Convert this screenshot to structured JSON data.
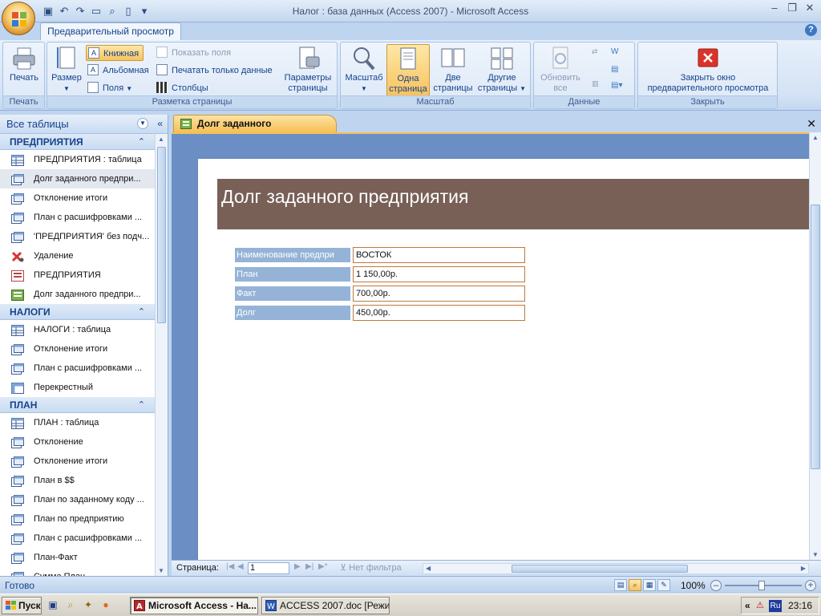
{
  "window": {
    "title": "Налог : база данных (Access 2007) - Microsoft Access"
  },
  "ribbon": {
    "tab": "Предварительный просмотр",
    "groups": {
      "print": {
        "label": "Печать",
        "print_btn": "Печать"
      },
      "page_layout": {
        "label": "Разметка страницы",
        "size_btn": "Размер",
        "portrait_btn": "Книжная",
        "landscape_btn": "Альбомная",
        "margins_btn": "Поля",
        "show_margins": "Показать поля",
        "print_data_only": "Печатать только данные",
        "columns_btn": "Столбцы",
        "page_setup_btn_line1": "Параметры",
        "page_setup_btn_line2": "страницы"
      },
      "zoom": {
        "label": "Масштаб",
        "zoom_btn": "Масштаб",
        "one_page_line1": "Одна",
        "one_page_line2": "страница",
        "two_pages_line1": "Две",
        "two_pages_line2": "страницы",
        "more_pages_line1": "Другие",
        "more_pages_line2": "страницы"
      },
      "data": {
        "label": "Данные",
        "refresh_line1": "Обновить",
        "refresh_line2": "все"
      },
      "close": {
        "label": "Закрыть",
        "close_line1": "Закрыть окно",
        "close_line2": "предварительного просмотра"
      }
    }
  },
  "nav": {
    "header": "Все таблицы",
    "groups": [
      {
        "title": "ПРЕДПРИЯТИЯ",
        "items": [
          {
            "label": "ПРЕДПРИЯТИЯ : таблица",
            "icon": "table-icon"
          },
          {
            "label": "Долг заданного предпри...",
            "icon": "query-icon",
            "selected": true
          },
          {
            "label": "Отклонение итоги",
            "icon": "query-icon"
          },
          {
            "label": "План с расшифровками ...",
            "icon": "query-icon"
          },
          {
            "label": "'ПРЕДПРИЯТИЯ' без подч...",
            "icon": "query-icon"
          },
          {
            "label": "Удаление",
            "icon": "delete-query-icon"
          },
          {
            "label": "ПРЕДПРИЯТИЯ",
            "icon": "form-icon"
          },
          {
            "label": "Долг заданного предпри...",
            "icon": "report-icon"
          }
        ]
      },
      {
        "title": "НАЛОГИ",
        "items": [
          {
            "label": "НАЛОГИ : таблица",
            "icon": "table-icon"
          },
          {
            "label": "Отклонение итоги",
            "icon": "query-icon"
          },
          {
            "label": "План с расшифровками ...",
            "icon": "query-icon"
          },
          {
            "label": "Перекрестный",
            "icon": "crosstab-icon"
          }
        ]
      },
      {
        "title": "ПЛАН",
        "items": [
          {
            "label": "ПЛАН : таблица",
            "icon": "table-icon"
          },
          {
            "label": "Отклонение",
            "icon": "query-icon"
          },
          {
            "label": "Отклонение итоги",
            "icon": "query-icon"
          },
          {
            "label": "План в $$",
            "icon": "query-icon"
          },
          {
            "label": "План по заданному коду ...",
            "icon": "query-icon"
          },
          {
            "label": "План по предприятию",
            "icon": "query-icon"
          },
          {
            "label": "План с расшифровками ...",
            "icon": "query-icon"
          },
          {
            "label": "План-Факт",
            "icon": "query-icon"
          },
          {
            "label": "Сумма План",
            "icon": "query-icon"
          }
        ]
      }
    ]
  },
  "document": {
    "tab": "Долг заданного предприятия",
    "report": {
      "title": "Долг заданного предприятия",
      "rows": [
        {
          "label": "Наименование предпри",
          "value": "ВОСТОК"
        },
        {
          "label": "План",
          "value": "1 150,00р."
        },
        {
          "label": "Факт",
          "value": "700,00р."
        },
        {
          "label": "Долг",
          "value": "450,00р."
        }
      ]
    }
  },
  "pagebar": {
    "label": "Страница:",
    "page": "1",
    "filter": "Нет фильтра"
  },
  "status": {
    "text": "Готово",
    "zoom": "100%"
  },
  "taskbar": {
    "start": "Пуск",
    "tasks": [
      {
        "label": "Microsoft Access - На...",
        "active": true
      },
      {
        "label": "ACCESS 2007.doc [Режи...",
        "active": false
      }
    ],
    "lang": "Ru",
    "clock": "23:16"
  },
  "colors": {
    "report_header": "#786057",
    "label_bg": "#95b3d7",
    "value_border": "#c0783c",
    "doc_bg": "#6b8fc4",
    "active_tab": "#f6bf55"
  }
}
